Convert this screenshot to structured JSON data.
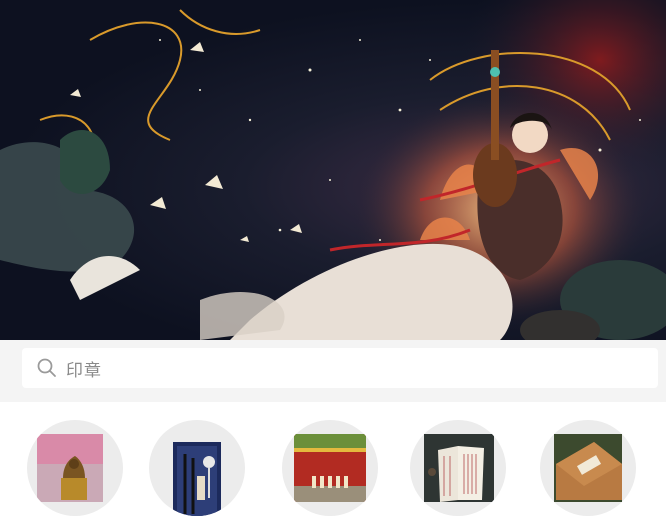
{
  "banner": {
    "alt_icon": "illustration-pipa-lady-night-sky"
  },
  "search": {
    "placeholder": "印章",
    "icon": "search-icon"
  },
  "categories": [
    {
      "icon": "seal-stamp-thumbnail"
    },
    {
      "icon": "calligraphy-brush-set-thumbnail"
    },
    {
      "icon": "palace-wall-figurines-thumbnail"
    },
    {
      "icon": "book-scroll-thumbnail"
    },
    {
      "icon": "gift-box-thumbnail"
    }
  ],
  "colors": {
    "page_bg": "#f4f4f4",
    "search_bg": "#ffffff",
    "placeholder": "#8a8a8a",
    "circle_bg": "#ececec"
  }
}
